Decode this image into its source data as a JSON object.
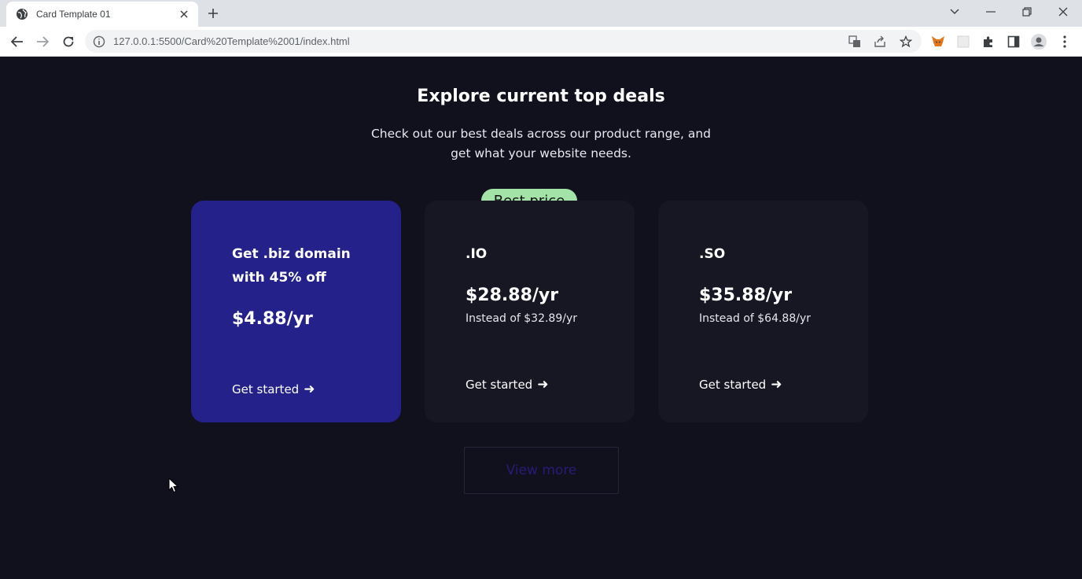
{
  "browser": {
    "tab_title": "Card Template 01",
    "url": "127.0.0.1:5500/Card%20Template%2001/index.html"
  },
  "page": {
    "heading": "Explore current top deals",
    "subtitle_line1": "Check out our best deals across our product range, and",
    "subtitle_line2": "get what your website needs.",
    "badge": "Best price",
    "cards": [
      {
        "name_line1": "Get .biz domain",
        "name_line2": "with 45% off",
        "price": "$4.88/yr",
        "cta": "Get started"
      },
      {
        "name": ".IO",
        "price": "$28.88/yr",
        "old_price": "Instead of $32.89/yr",
        "cta": "Get started"
      },
      {
        "name": ".SO",
        "price": "$35.88/yr",
        "old_price": "Instead of $64.88/yr",
        "cta": "Get started"
      }
    ],
    "view_more": "View more"
  },
  "colors": {
    "background": "#11111e",
    "featured_card": "#24218a",
    "card": "#171723",
    "badge": "#a3e3a8"
  }
}
